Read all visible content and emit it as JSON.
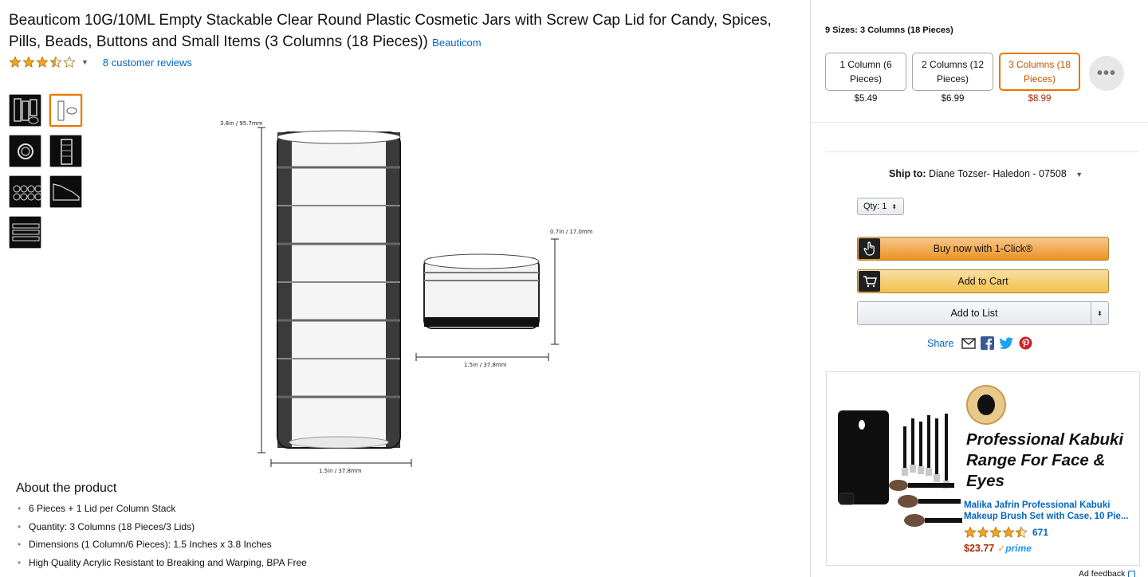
{
  "product": {
    "title": "Beauticom 10G/10ML Empty Stackable Clear Round Plastic Cosmetic Jars with Screw Cap Lid for Candy, Spices, Pills, Beads, Buttons and Small Items (3 Columns (18 Pieces))",
    "brand": "Beauticom",
    "rating": 3.5,
    "reviews_label": "8 customer reviews"
  },
  "thumbnails": [
    {
      "name": "thumb-1",
      "selected": false
    },
    {
      "name": "thumb-2",
      "selected": true
    },
    {
      "name": "thumb-3",
      "selected": false
    },
    {
      "name": "thumb-4",
      "selected": false
    },
    {
      "name": "thumb-5",
      "selected": false
    },
    {
      "name": "thumb-6",
      "selected": false
    },
    {
      "name": "thumb-7",
      "selected": false
    }
  ],
  "image_dims": {
    "height_label": "3.8in / 95.7mm",
    "width_label": "1.5in / 37.8mm",
    "small_height_label": "0.7in / 17.0mm",
    "small_width_label": "1.5in / 37.8mm"
  },
  "about": {
    "heading": "About the product",
    "bullets": [
      "6 Pieces + 1 Lid per Column Stack",
      "Quantity: 3 Columns (18 Pieces/3 Lids)",
      "Dimensions (1 Column/6 Pieces): 1.5 Inches x 3.8 Inches",
      "High Quality Acrylic Resistant to Breaking and Warping, BPA Free"
    ]
  },
  "sizes": {
    "label": "9 Sizes: 3 Columns (18 Pieces)",
    "options": [
      {
        "label": "1 Column (6 Pieces)",
        "price": "$5.49",
        "selected": false
      },
      {
        "label": "2 Columns (12 Pieces)",
        "price": "$6.99",
        "selected": false
      },
      {
        "label": "3 Columns (18 Pieces)",
        "price": "$8.99",
        "selected": true
      }
    ],
    "more_label": "•••"
  },
  "ship": {
    "label": "Ship to:",
    "address": "Diane Tozser- Haledon - 07508"
  },
  "qty": {
    "label": "Qty:",
    "value": "1"
  },
  "buttons": {
    "buy_now": "Buy now with 1-Click®",
    "add_to_cart": "Add to Cart",
    "add_to_list": "Add to List"
  },
  "share": {
    "label": "Share"
  },
  "ad": {
    "headline": "Professional Kabuki Range For Face & Eyes",
    "product_name": "Malika Jafrin Professional Kabuki Makeup Brush Set with Case, 10 Pie...",
    "rating": 4.5,
    "review_count": "671",
    "price": "$23.77",
    "prime_label": "prime",
    "feedback_label": "Ad feedback"
  },
  "colors": {
    "link": "#0066c0",
    "price": "#b12704",
    "selected_border": "#e77600",
    "star": "#f4a41d"
  }
}
